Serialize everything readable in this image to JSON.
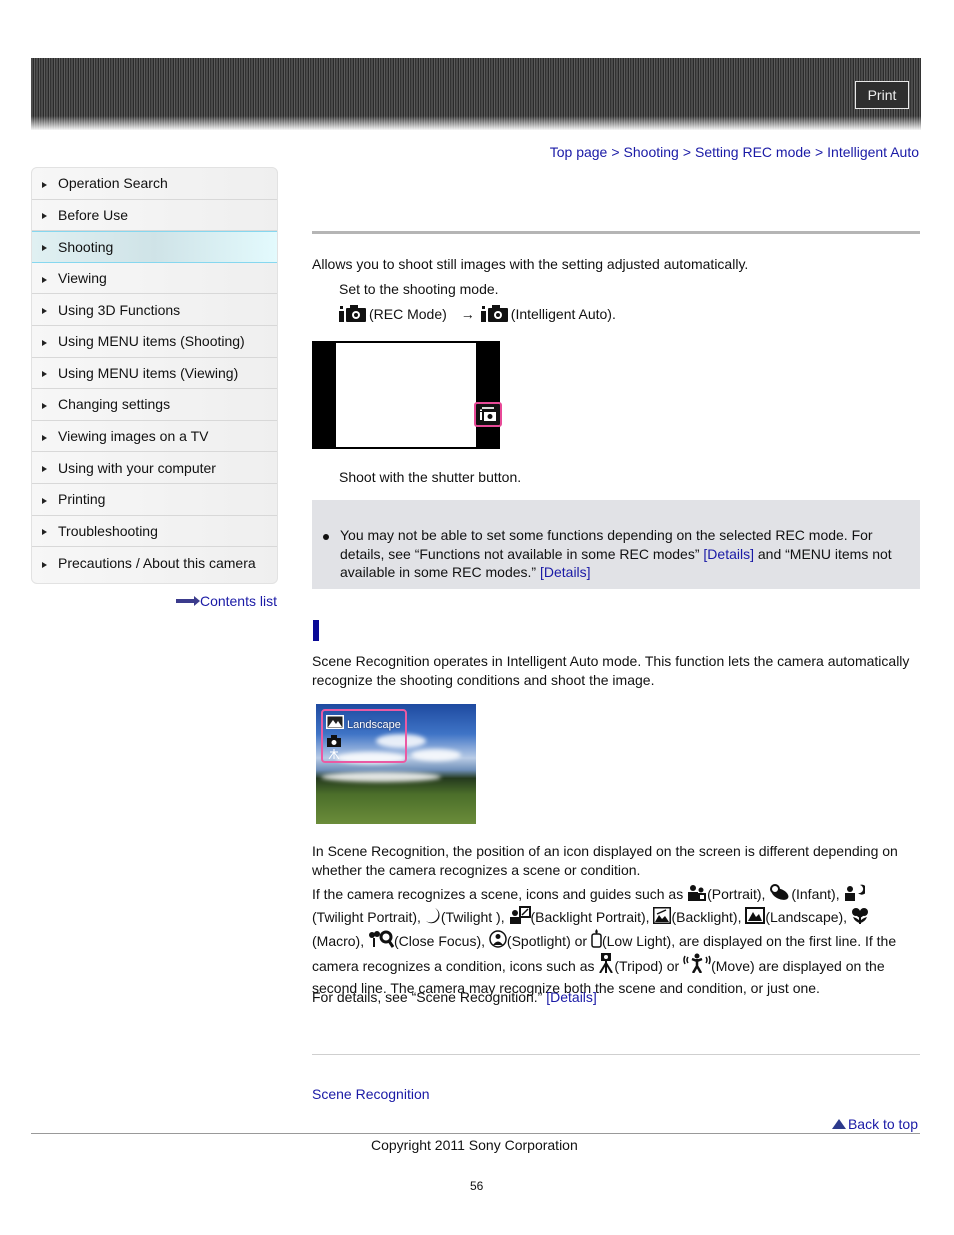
{
  "header": {
    "print_label": "Print"
  },
  "breadcrumb": [
    {
      "label": "Top page"
    },
    {
      "label": "Shooting"
    },
    {
      "label": "Setting REC mode"
    },
    {
      "label": "Intelligent Auto"
    }
  ],
  "breadcrumb_separator": ">",
  "sidebar": {
    "items": [
      {
        "label": "Operation Search",
        "active": false
      },
      {
        "label": "Before Use",
        "active": false
      },
      {
        "label": "Shooting",
        "active": true
      },
      {
        "label": "Viewing",
        "active": false
      },
      {
        "label": "Using 3D Functions",
        "active": false
      },
      {
        "label": "Using MENU items (Shooting)",
        "active": false
      },
      {
        "label": "Using MENU items (Viewing)",
        "active": false
      },
      {
        "label": "Changing settings",
        "active": false
      },
      {
        "label": "Viewing images on a TV",
        "active": false
      },
      {
        "label": "Using with your computer",
        "active": false
      },
      {
        "label": "Printing",
        "active": false
      },
      {
        "label": "Troubleshooting",
        "active": false
      },
      {
        "label": "Precautions / About this camera",
        "active": false
      }
    ],
    "contents_list_label": "Contents list"
  },
  "main": {
    "intro": "Allows you to shoot still images with the setting adjusted automatically.",
    "step1": "Set to the shooting mode.",
    "step1_rec_mode": "(REC Mode)",
    "step1_arrow": "→",
    "step1_intelligent": "(Intelligent Auto).",
    "step2": "Shoot with the shutter button.",
    "note": {
      "text_a": "You may not be able to set some functions depending on the selected REC mode. For details, see “Functions not available in some REC modes” ",
      "link1": "[Details]",
      "text_b": " and “MENU items not available in some REC modes.” ",
      "link2": "[Details]"
    },
    "scene_intro": "Scene Recognition operates in Intelligent Auto mode. This function lets the camera automatically recognize the shooting conditions and shoot the image.",
    "scene_image_label": "Landscape",
    "para1": "In Scene Recognition, the position of an icon displayed on the screen is different depending on whether the camera recognizes a scene or condition.",
    "para2": {
      "lead": "If the camera recognizes a scene, icons and guides such as ",
      "portrait": "(Portrait), ",
      "infant": "(Infant), ",
      "twilight_portrait": "(Twilight Portrait), ",
      "twilight": "(Twilight ), ",
      "backlight_portrait": "(Backlight Portrait), ",
      "backlight": "(Backlight), ",
      "landscape": "(Landscape), ",
      "macro": "(Macro), ",
      "close_focus": "(Close Focus), ",
      "spotlight": "(Spotlight) or ",
      "low_light": "(Low Light), are displayed on the first line. If the camera recognizes a condition, icons such as ",
      "tripod": "(Tripod) or ",
      "move": "(Move) are displayed on the second line. The camera may recognize both the scene and condition, or just one."
    },
    "para3_text": "For details, see “Scene Recognition.” ",
    "para3_link": "[Details]",
    "related_link": "Scene Recognition"
  },
  "footer": {
    "back_to_top": "Back to top",
    "copyright": "Copyright 2011 Sony Corporation",
    "page_number": "56"
  }
}
